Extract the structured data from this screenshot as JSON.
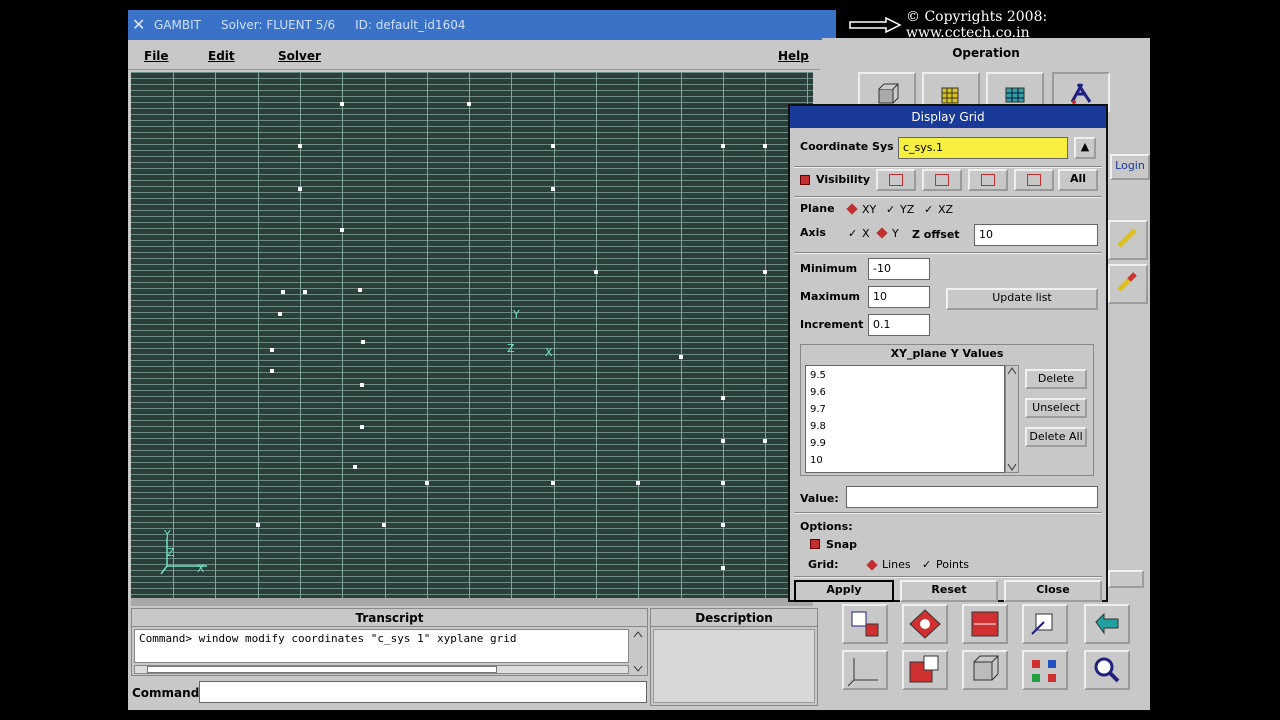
{
  "copyright": "© Copyrights 2008: www.cctech.co.in",
  "window": {
    "app": "GAMBIT",
    "solver": "Solver: FLUENT 5/6",
    "id": "ID: default_id1604"
  },
  "menu": {
    "file": "File",
    "edit": "Edit",
    "solver": "Solver",
    "help": "Help"
  },
  "graphics": {
    "axis_y": "Y",
    "axis_x": "X",
    "axis_z": "Z",
    "center_y": "Y",
    "center_x": "X",
    "center_z": "Z"
  },
  "transcript": {
    "header": "Transcript",
    "text": "Command> window modify coordinates \"c_sys 1\" xyplane grid"
  },
  "description": {
    "header": "Description"
  },
  "command": {
    "label": "Command:",
    "value": ""
  },
  "operation": {
    "title": "Operation",
    "login_button": "Login"
  },
  "dialog": {
    "title": "Display Grid",
    "coord_sys_label": "Coordinate Sys",
    "coord_sys_value": "c_sys.1",
    "visibility_label": "Visibility",
    "visibility_all": "All",
    "plane_label": "Plane",
    "plane_xy": "XY",
    "plane_yz": "YZ",
    "plane_xz": "XZ",
    "axis_label": "Axis",
    "axis_x": "X",
    "axis_y": "Y",
    "zoffset_label": "Z offset",
    "zoffset_value": "10",
    "minimum_label": "Minimum",
    "minimum_value": "-10",
    "maximum_label": "Maximum",
    "maximum_value": "10",
    "increment_label": "Increment",
    "increment_value": "0.1",
    "update_list": "Update list",
    "list_header": "XY_plane Y Values",
    "list_values": [
      "9.5",
      "9.6",
      "9.7",
      "9.8",
      "9.9",
      "10"
    ],
    "delete": "Delete",
    "unselect": "Unselect",
    "delete_all": "Delete All",
    "value_label": "Value:",
    "value_value": "",
    "options_label": "Options:",
    "snap_label": "Snap",
    "grid_label": "Grid:",
    "grid_lines": "Lines",
    "grid_points": "Points",
    "apply": "Apply",
    "reset": "Reset",
    "close": "Close"
  }
}
